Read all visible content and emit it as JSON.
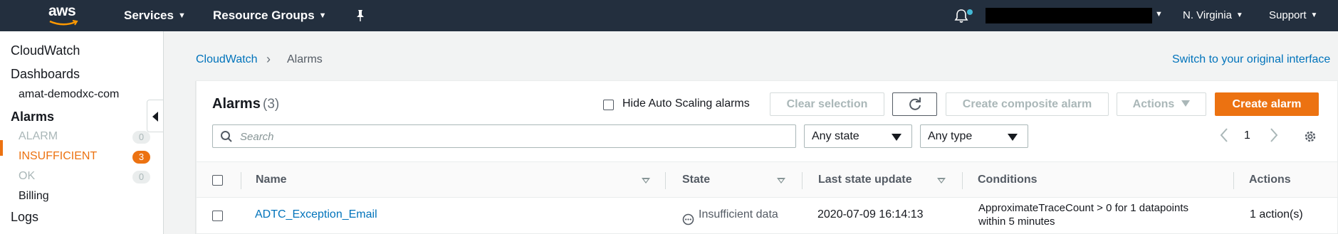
{
  "topnav": {
    "logo_text": "aws",
    "services": "Services",
    "resource_groups": "Resource Groups",
    "region": "N. Virginia",
    "support": "Support"
  },
  "sidebar": {
    "cloudwatch": "CloudWatch",
    "dashboards": "Dashboards",
    "dashboard_item": "amat-demodxc-com",
    "alarms": "Alarms",
    "alarm_states": [
      {
        "label": "ALARM",
        "count": "0"
      },
      {
        "label": "INSUFFICIENT",
        "count": "3"
      },
      {
        "label": "OK",
        "count": "0"
      }
    ],
    "billing": "Billing",
    "logs": "Logs"
  },
  "breadcrumb": {
    "root": "CloudWatch",
    "current": "Alarms",
    "separator": "›"
  },
  "switch_link": "Switch to your original interface",
  "panel": {
    "title": "Alarms",
    "count": "(3)",
    "hide_autoscaling_label": "Hide Auto Scaling alarms",
    "clear_selection": "Clear selection",
    "create_composite": "Create composite alarm",
    "actions": "Actions",
    "create_alarm": "Create alarm",
    "search_placeholder": "Search",
    "state_filter": "Any state",
    "type_filter": "Any type",
    "page": "1"
  },
  "table": {
    "columns": [
      "Name",
      "State",
      "Last state update",
      "Conditions",
      "Actions"
    ],
    "rows": [
      {
        "name": "ADTC_Exception_Email",
        "state": "Insufficient data",
        "last_update": "2020-07-09 16:14:13",
        "conditions_line1": "ApproximateTraceCount > 0 for 1 datapoints",
        "conditions_line2": "within 5 minutes",
        "actions": "1 action(s)"
      }
    ]
  },
  "colors": {
    "nav_bg": "#232f3e",
    "accent_orange": "#ec7211",
    "link_blue": "#0073bb",
    "notification_dot": "#44b9d6"
  }
}
